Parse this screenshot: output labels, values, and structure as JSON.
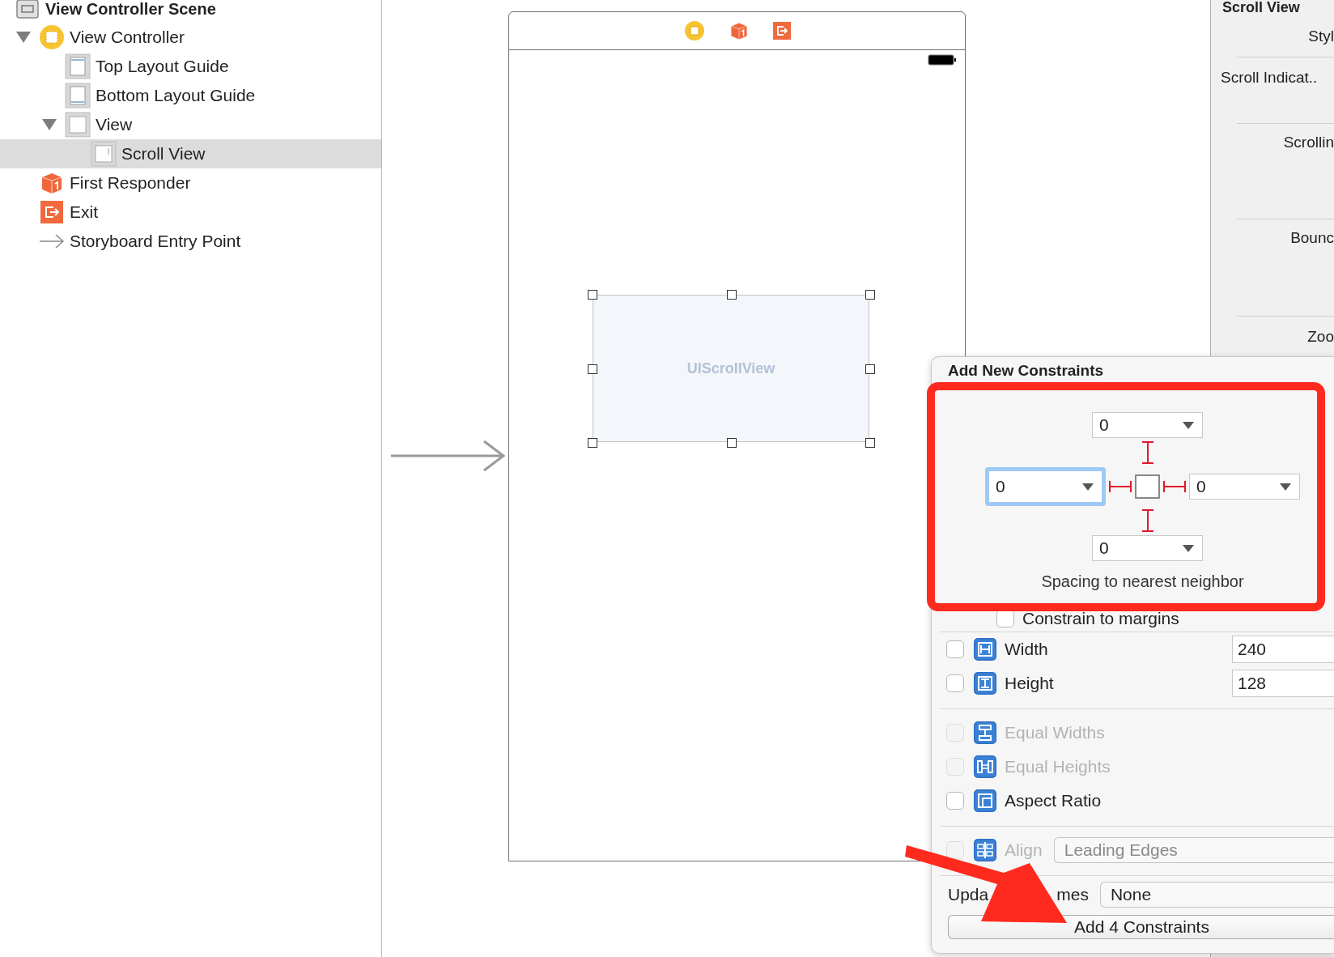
{
  "outline": {
    "scene": {
      "label": "View Controller Scene",
      "kind": "scene"
    },
    "items": [
      {
        "label": "View Controller",
        "kind": "view-controller",
        "expanded": true,
        "selected": false,
        "children": [
          {
            "label": "Top Layout Guide",
            "kind": "top-guide",
            "selected": false
          },
          {
            "label": "Bottom Layout Guide",
            "kind": "bottom-guide",
            "selected": false
          },
          {
            "label": "View",
            "kind": "view",
            "expanded": true,
            "selected": false,
            "children": [
              {
                "label": "Scroll View",
                "kind": "scroll-view",
                "selected": true
              }
            ]
          }
        ]
      },
      {
        "label": "First Responder",
        "kind": "first-responder",
        "selected": false
      },
      {
        "label": "Exit",
        "kind": "exit",
        "selected": false
      },
      {
        "label": "Storyboard Entry Point",
        "kind": "entry-point",
        "selected": false
      }
    ]
  },
  "canvas": {
    "scroll_view": {
      "label": "UIScrollView"
    }
  },
  "inspector": {
    "title": "Scroll View",
    "rows": [
      "Styl",
      "Scroll Indicat..",
      "Scrollin",
      "Bounc",
      "Zoo"
    ]
  },
  "popover": {
    "title": "Add New Constraints",
    "spacing": [
      {
        "value": "0",
        "focused": false
      },
      {
        "value": "0",
        "focused": true
      },
      {
        "value": "0",
        "focused": false
      },
      {
        "value": "0",
        "focused": false
      }
    ],
    "caption": "Spacing to nearest neighbor",
    "constrain_to_margins": {
      "label": "Constrain to margins",
      "checked": false
    },
    "rows": [
      {
        "kind": "width",
        "label": "Width",
        "checked": false,
        "disabled": false,
        "value": "240"
      },
      {
        "kind": "height",
        "label": "Height",
        "checked": false,
        "disabled": false,
        "value": "128"
      },
      {
        "kind": "equal-widths",
        "label": "Equal Widths",
        "checked": false,
        "disabled": true
      },
      {
        "kind": "equal-heights",
        "label": "Equal Heights",
        "checked": false,
        "disabled": true
      },
      {
        "kind": "aspect-ratio",
        "label": "Aspect Ratio",
        "checked": false,
        "disabled": false
      }
    ],
    "align": {
      "label": "Align",
      "value": "Leading Edges",
      "checked": false,
      "disabled": true
    },
    "update_frames": {
      "label_parts": [
        "Upda",
        "mes"
      ],
      "value": "None"
    },
    "button": "Add 4 Constraints"
  }
}
